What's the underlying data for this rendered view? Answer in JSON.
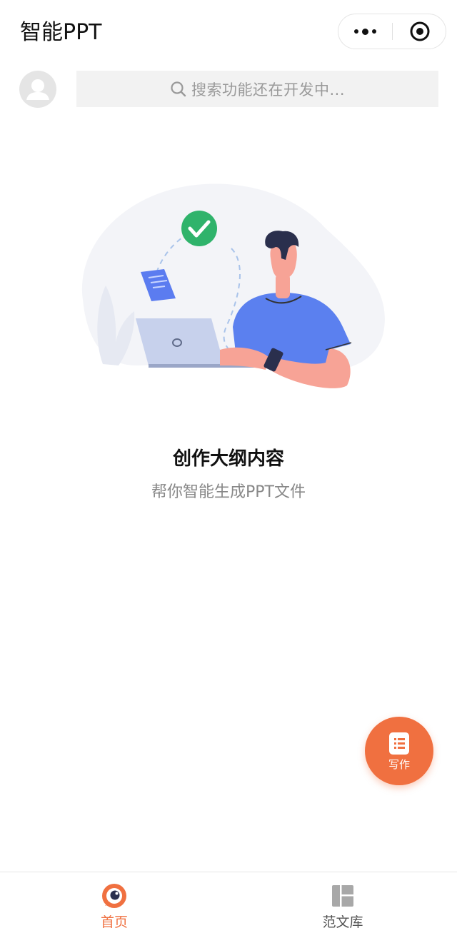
{
  "header": {
    "title": "智能PPT",
    "more_icon": "more-dots-icon",
    "close_icon": "target-circle-icon"
  },
  "search": {
    "placeholder": "搜索功能还在开发中..."
  },
  "empty_state": {
    "title": "创作大纲内容",
    "subtitle": "帮你智能生成PPT文件"
  },
  "fab": {
    "label": "写作",
    "color": "#F07040"
  },
  "tabbar": {
    "items": [
      {
        "label": "首页",
        "icon": "home-eye-icon",
        "active": true
      },
      {
        "label": "范文库",
        "icon": "layout-grid-icon",
        "active": false
      }
    ],
    "active_color": "#F07040"
  }
}
